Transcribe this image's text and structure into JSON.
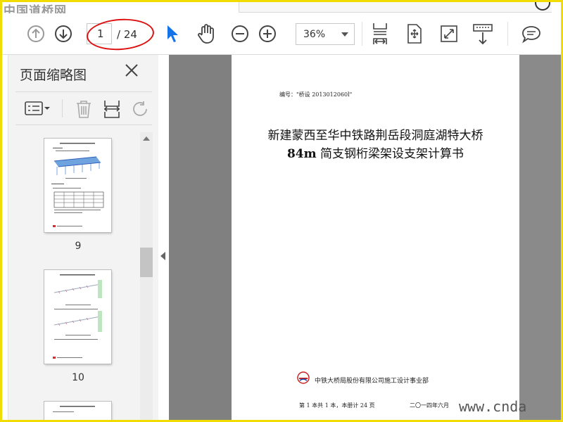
{
  "watermark_top": "中国道桥网",
  "watermark_bottom": "www.cnda",
  "toolbar": {
    "page_current": "1",
    "page_total": "/ 24",
    "zoom": "36%",
    "icons": [
      "prev-page-icon",
      "next-page-icon",
      "select-arrow-icon",
      "hand-tool-icon",
      "zoom-out-icon",
      "zoom-in-icon",
      "fit-page-icon",
      "rotate-page-icon",
      "full-screen-icon",
      "scroll-mode-icon",
      "comment-icon"
    ]
  },
  "panel": {
    "title": "页面缩略图",
    "thumbnails": [
      {
        "label": "9"
      },
      {
        "label": "10"
      }
    ]
  },
  "document": {
    "number": "编号：\"桥设 2013012060l\"",
    "title_line1": "新建蒙西至华中铁路荆岳段洞庭湖特大桥",
    "title_line2_bold": "84m",
    "title_line2_rest": " 简支钢桁梁架设支架计算书",
    "company": "中铁大桥局股份有限公司施工设计事业部",
    "footer_left": "第 1 本共 1 本，本册计 24 页",
    "footer_right": "二〇一四年六月"
  },
  "colors": {
    "frame_border": "#f0dc00",
    "annotation_ellipse": "#dd1111",
    "select_tool": "#1473e6"
  }
}
